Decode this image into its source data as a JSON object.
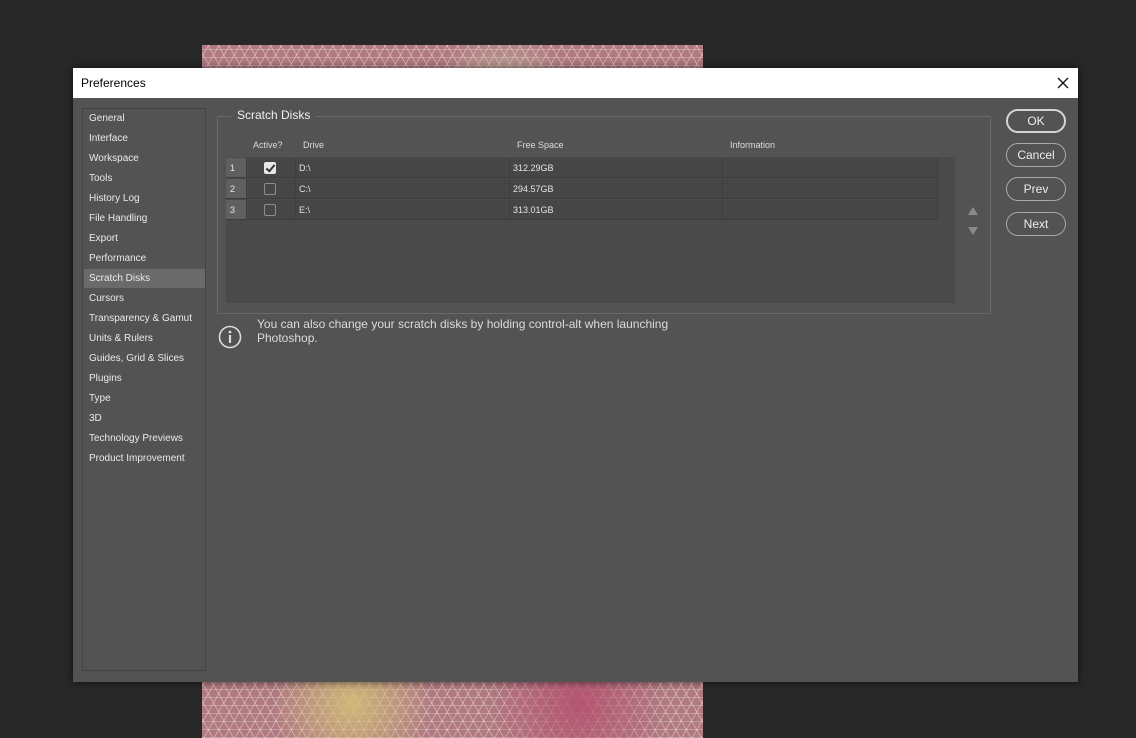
{
  "dialog": {
    "title": "Preferences"
  },
  "sidebar": {
    "items": [
      {
        "label": "General"
      },
      {
        "label": "Interface"
      },
      {
        "label": "Workspace"
      },
      {
        "label": "Tools"
      },
      {
        "label": "History Log"
      },
      {
        "label": "File Handling"
      },
      {
        "label": "Export"
      },
      {
        "label": "Performance"
      },
      {
        "label": "Scratch Disks"
      },
      {
        "label": "Cursors"
      },
      {
        "label": "Transparency & Gamut"
      },
      {
        "label": "Units & Rulers"
      },
      {
        "label": "Guides, Grid & Slices"
      },
      {
        "label": "Plugins"
      },
      {
        "label": "Type"
      },
      {
        "label": "3D"
      },
      {
        "label": "Technology Previews"
      },
      {
        "label": "Product Improvement"
      }
    ],
    "selected": "Scratch Disks"
  },
  "scratch": {
    "title": "Scratch Disks",
    "columns": {
      "active": "Active?",
      "drive": "Drive",
      "free_space": "Free Space",
      "information": "Information"
    },
    "rows": [
      {
        "num": "1",
        "active": true,
        "drive": "D:\\",
        "free": "312.29GB",
        "info": ""
      },
      {
        "num": "2",
        "active": false,
        "drive": "C:\\",
        "free": "294.57GB",
        "info": ""
      },
      {
        "num": "3",
        "active": false,
        "drive": "E:\\",
        "free": "313.01GB",
        "info": ""
      }
    ]
  },
  "info": {
    "text": "You can also change your scratch disks by holding control-alt when launching Photoshop."
  },
  "buttons": {
    "ok": "OK",
    "cancel": "Cancel",
    "prev": "Prev",
    "next": "Next"
  }
}
